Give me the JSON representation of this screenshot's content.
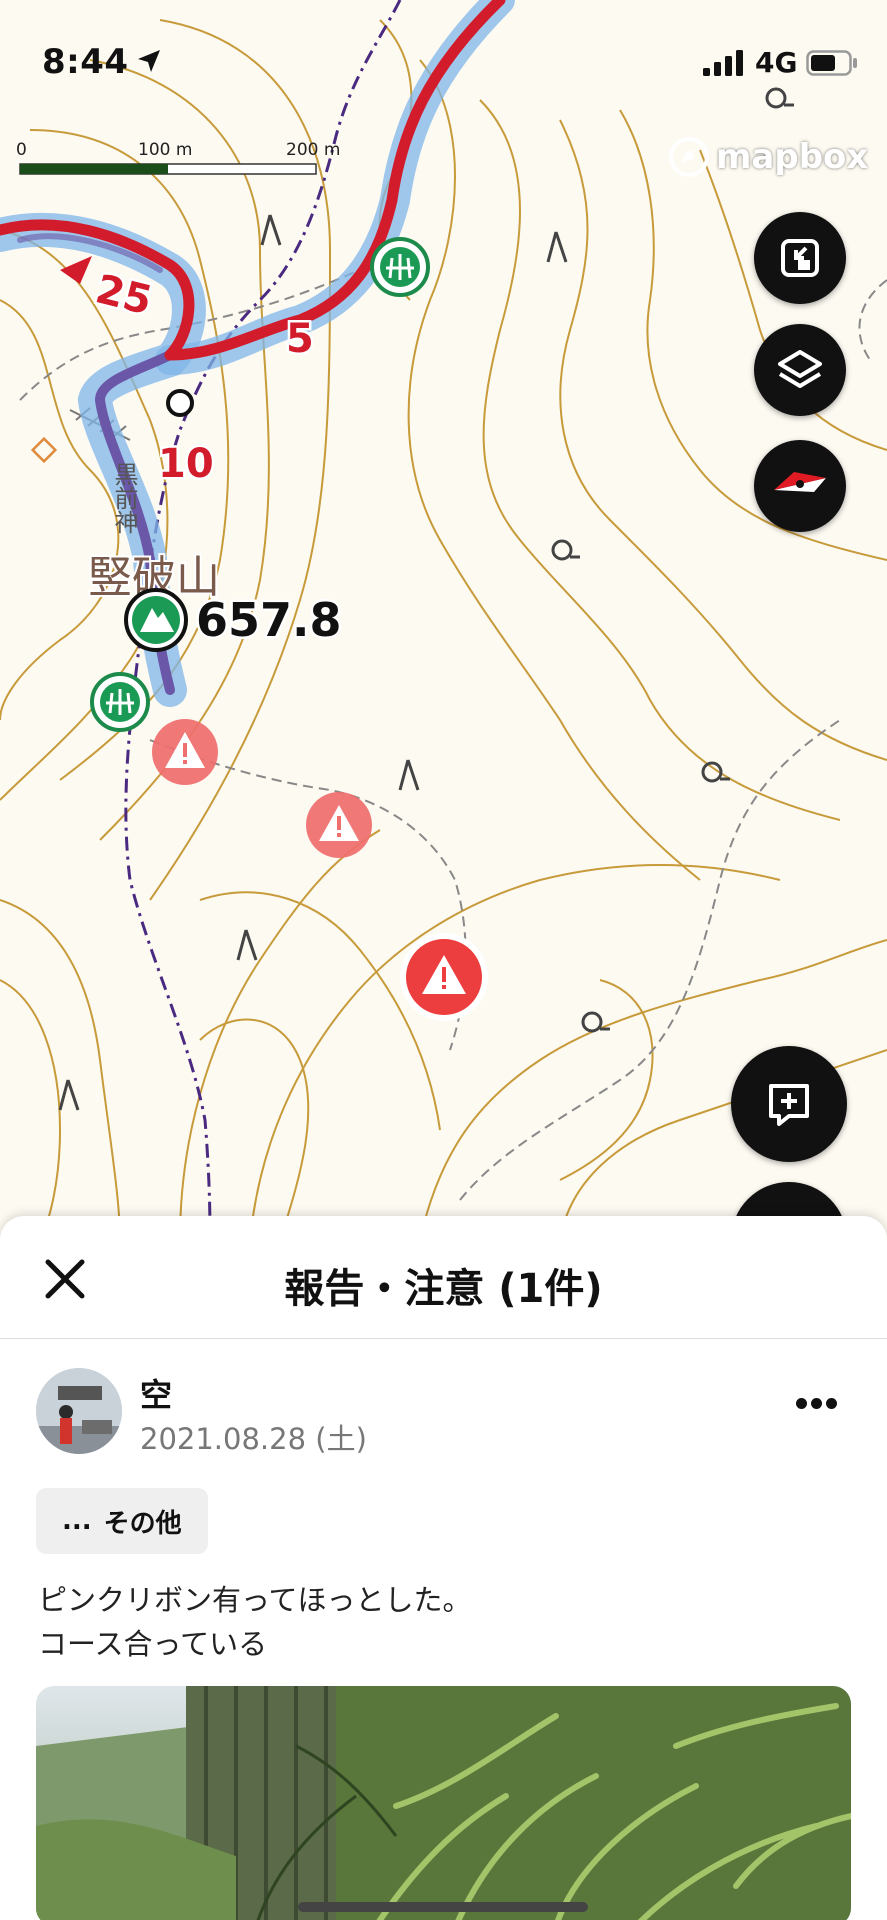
{
  "status_bar": {
    "time": "8:44",
    "network": "4G"
  },
  "map": {
    "scale_labels": [
      "0",
      "100 m",
      "200 m"
    ],
    "attribution": "mapbox",
    "peak_name": "竪破山",
    "peak_elevation": "657.8",
    "shrine_label": "黒前神",
    "route_markers": [
      "25",
      "5",
      "10"
    ],
    "colors": {
      "route": "#d21c2b",
      "route_halo": "#74b3e6",
      "contour": "#c79a3a",
      "warning": "#ee4b4b",
      "peak_green": "#1b8a4a"
    },
    "controls": [
      "fullscreen-exit-icon",
      "layers-icon",
      "compass-icon",
      "add-comment-icon"
    ]
  },
  "sheet": {
    "title": "報告・注意 (1件)",
    "post": {
      "username": "空",
      "date": "2021.08.28 (土)",
      "tag": {
        "icon": "...",
        "label": "その他"
      },
      "text_lines": [
        "ピンクリボン有ってほっとした。",
        "コース合っている"
      ]
    }
  }
}
